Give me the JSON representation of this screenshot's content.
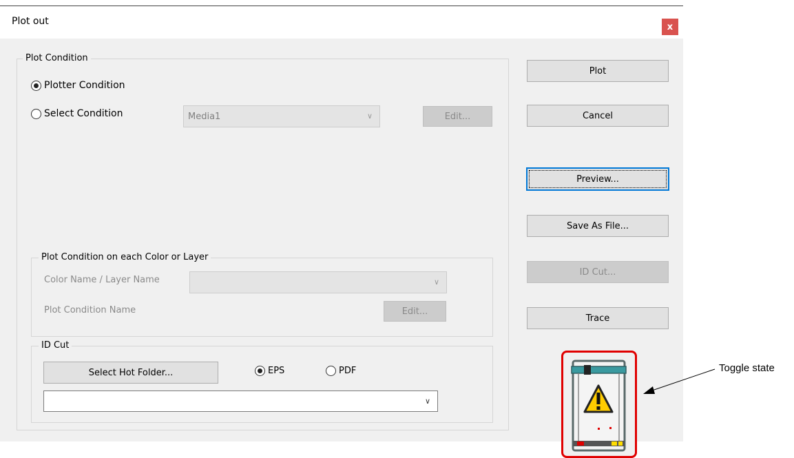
{
  "window": {
    "title": "Plot out",
    "close_label": "x"
  },
  "plot_condition": {
    "legend": "Plot Condition",
    "plotter_condition_label": "Plotter Condition",
    "plotter_condition_selected": true,
    "select_condition_label": "Select Condition",
    "select_condition_selected": false,
    "media_value": "Media1",
    "edit_label": "Edit..."
  },
  "color_layer": {
    "legend": "Plot Condition on each Color or Layer",
    "name_label": "Color Name / Layer Name",
    "name_value": "",
    "condition_label": "Plot Condition Name",
    "edit_label": "Edit..."
  },
  "id_cut": {
    "legend": "ID Cut",
    "hot_folder_label": "Select Hot Folder...",
    "eps_label": "EPS",
    "eps_selected": true,
    "pdf_label": "PDF",
    "pdf_selected": false,
    "folder_value": ""
  },
  "actions": {
    "plot": "Plot",
    "cancel": "Cancel",
    "preview": "Preview...",
    "save_as_file": "Save As File...",
    "id_cut": "ID Cut...",
    "trace": "Trace"
  },
  "status_icon": {
    "name": "plotter-warning-icon",
    "warning_color": "#ffcc00",
    "highlight_color": "#e00000"
  },
  "annotation": {
    "text": "Toggle state"
  }
}
